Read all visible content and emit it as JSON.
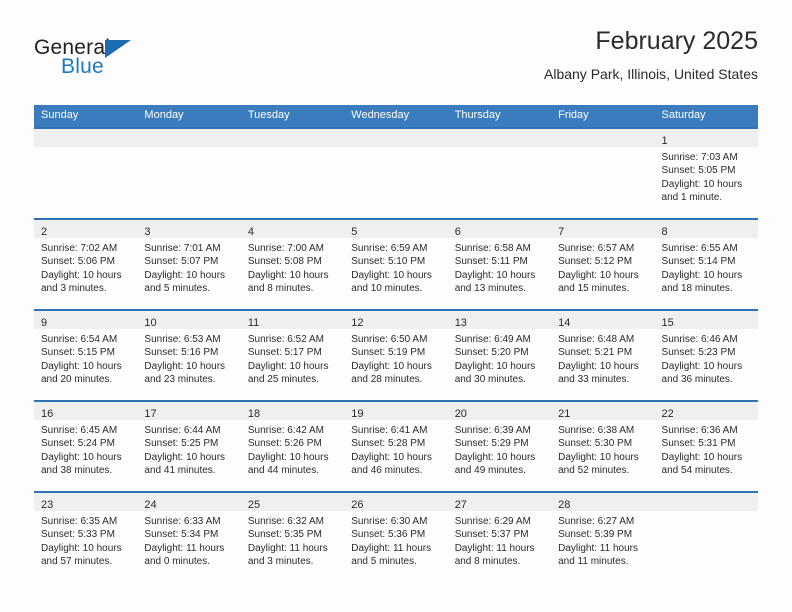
{
  "logo": {
    "word_one": "General",
    "word_two": "Blue",
    "triangle_color": "#1c6cb3"
  },
  "header": {
    "title": "February 2025",
    "subtitle": "Albany Park, Illinois, United States"
  },
  "theme": {
    "header_blue": "#3b7cbe",
    "row_rule_blue": "#2f72b5",
    "daynum_band": "#efefef",
    "text": "#2b2b2b"
  },
  "weekdays": [
    "Sunday",
    "Monday",
    "Tuesday",
    "Wednesday",
    "Thursday",
    "Friday",
    "Saturday"
  ],
  "weeks": [
    [
      {
        "day": ""
      },
      {
        "day": ""
      },
      {
        "day": ""
      },
      {
        "day": ""
      },
      {
        "day": ""
      },
      {
        "day": ""
      },
      {
        "day": "1",
        "sunrise": "Sunrise: 7:03 AM",
        "sunset": "Sunset: 5:05 PM",
        "daylight_line1": "Daylight: 10 hours",
        "daylight_line2": "and 1 minute."
      }
    ],
    [
      {
        "day": "2",
        "sunrise": "Sunrise: 7:02 AM",
        "sunset": "Sunset: 5:06 PM",
        "daylight_line1": "Daylight: 10 hours",
        "daylight_line2": "and 3 minutes."
      },
      {
        "day": "3",
        "sunrise": "Sunrise: 7:01 AM",
        "sunset": "Sunset: 5:07 PM",
        "daylight_line1": "Daylight: 10 hours",
        "daylight_line2": "and 5 minutes."
      },
      {
        "day": "4",
        "sunrise": "Sunrise: 7:00 AM",
        "sunset": "Sunset: 5:08 PM",
        "daylight_line1": "Daylight: 10 hours",
        "daylight_line2": "and 8 minutes."
      },
      {
        "day": "5",
        "sunrise": "Sunrise: 6:59 AM",
        "sunset": "Sunset: 5:10 PM",
        "daylight_line1": "Daylight: 10 hours",
        "daylight_line2": "and 10 minutes."
      },
      {
        "day": "6",
        "sunrise": "Sunrise: 6:58 AM",
        "sunset": "Sunset: 5:11 PM",
        "daylight_line1": "Daylight: 10 hours",
        "daylight_line2": "and 13 minutes."
      },
      {
        "day": "7",
        "sunrise": "Sunrise: 6:57 AM",
        "sunset": "Sunset: 5:12 PM",
        "daylight_line1": "Daylight: 10 hours",
        "daylight_line2": "and 15 minutes."
      },
      {
        "day": "8",
        "sunrise": "Sunrise: 6:55 AM",
        "sunset": "Sunset: 5:14 PM",
        "daylight_line1": "Daylight: 10 hours",
        "daylight_line2": "and 18 minutes."
      }
    ],
    [
      {
        "day": "9",
        "sunrise": "Sunrise: 6:54 AM",
        "sunset": "Sunset: 5:15 PM",
        "daylight_line1": "Daylight: 10 hours",
        "daylight_line2": "and 20 minutes."
      },
      {
        "day": "10",
        "sunrise": "Sunrise: 6:53 AM",
        "sunset": "Sunset: 5:16 PM",
        "daylight_line1": "Daylight: 10 hours",
        "daylight_line2": "and 23 minutes."
      },
      {
        "day": "11",
        "sunrise": "Sunrise: 6:52 AM",
        "sunset": "Sunset: 5:17 PM",
        "daylight_line1": "Daylight: 10 hours",
        "daylight_line2": "and 25 minutes."
      },
      {
        "day": "12",
        "sunrise": "Sunrise: 6:50 AM",
        "sunset": "Sunset: 5:19 PM",
        "daylight_line1": "Daylight: 10 hours",
        "daylight_line2": "and 28 minutes."
      },
      {
        "day": "13",
        "sunrise": "Sunrise: 6:49 AM",
        "sunset": "Sunset: 5:20 PM",
        "daylight_line1": "Daylight: 10 hours",
        "daylight_line2": "and 30 minutes."
      },
      {
        "day": "14",
        "sunrise": "Sunrise: 6:48 AM",
        "sunset": "Sunset: 5:21 PM",
        "daylight_line1": "Daylight: 10 hours",
        "daylight_line2": "and 33 minutes."
      },
      {
        "day": "15",
        "sunrise": "Sunrise: 6:46 AM",
        "sunset": "Sunset: 5:23 PM",
        "daylight_line1": "Daylight: 10 hours",
        "daylight_line2": "and 36 minutes."
      }
    ],
    [
      {
        "day": "16",
        "sunrise": "Sunrise: 6:45 AM",
        "sunset": "Sunset: 5:24 PM",
        "daylight_line1": "Daylight: 10 hours",
        "daylight_line2": "and 38 minutes."
      },
      {
        "day": "17",
        "sunrise": "Sunrise: 6:44 AM",
        "sunset": "Sunset: 5:25 PM",
        "daylight_line1": "Daylight: 10 hours",
        "daylight_line2": "and 41 minutes."
      },
      {
        "day": "18",
        "sunrise": "Sunrise: 6:42 AM",
        "sunset": "Sunset: 5:26 PM",
        "daylight_line1": "Daylight: 10 hours",
        "daylight_line2": "and 44 minutes."
      },
      {
        "day": "19",
        "sunrise": "Sunrise: 6:41 AM",
        "sunset": "Sunset: 5:28 PM",
        "daylight_line1": "Daylight: 10 hours",
        "daylight_line2": "and 46 minutes."
      },
      {
        "day": "20",
        "sunrise": "Sunrise: 6:39 AM",
        "sunset": "Sunset: 5:29 PM",
        "daylight_line1": "Daylight: 10 hours",
        "daylight_line2": "and 49 minutes."
      },
      {
        "day": "21",
        "sunrise": "Sunrise: 6:38 AM",
        "sunset": "Sunset: 5:30 PM",
        "daylight_line1": "Daylight: 10 hours",
        "daylight_line2": "and 52 minutes."
      },
      {
        "day": "22",
        "sunrise": "Sunrise: 6:36 AM",
        "sunset": "Sunset: 5:31 PM",
        "daylight_line1": "Daylight: 10 hours",
        "daylight_line2": "and 54 minutes."
      }
    ],
    [
      {
        "day": "23",
        "sunrise": "Sunrise: 6:35 AM",
        "sunset": "Sunset: 5:33 PM",
        "daylight_line1": "Daylight: 10 hours",
        "daylight_line2": "and 57 minutes."
      },
      {
        "day": "24",
        "sunrise": "Sunrise: 6:33 AM",
        "sunset": "Sunset: 5:34 PM",
        "daylight_line1": "Daylight: 11 hours",
        "daylight_line2": "and 0 minutes."
      },
      {
        "day": "25",
        "sunrise": "Sunrise: 6:32 AM",
        "sunset": "Sunset: 5:35 PM",
        "daylight_line1": "Daylight: 11 hours",
        "daylight_line2": "and 3 minutes."
      },
      {
        "day": "26",
        "sunrise": "Sunrise: 6:30 AM",
        "sunset": "Sunset: 5:36 PM",
        "daylight_line1": "Daylight: 11 hours",
        "daylight_line2": "and 5 minutes."
      },
      {
        "day": "27",
        "sunrise": "Sunrise: 6:29 AM",
        "sunset": "Sunset: 5:37 PM",
        "daylight_line1": "Daylight: 11 hours",
        "daylight_line2": "and 8 minutes."
      },
      {
        "day": "28",
        "sunrise": "Sunrise: 6:27 AM",
        "sunset": "Sunset: 5:39 PM",
        "daylight_line1": "Daylight: 11 hours",
        "daylight_line2": "and 11 minutes."
      },
      {
        "day": ""
      }
    ]
  ]
}
